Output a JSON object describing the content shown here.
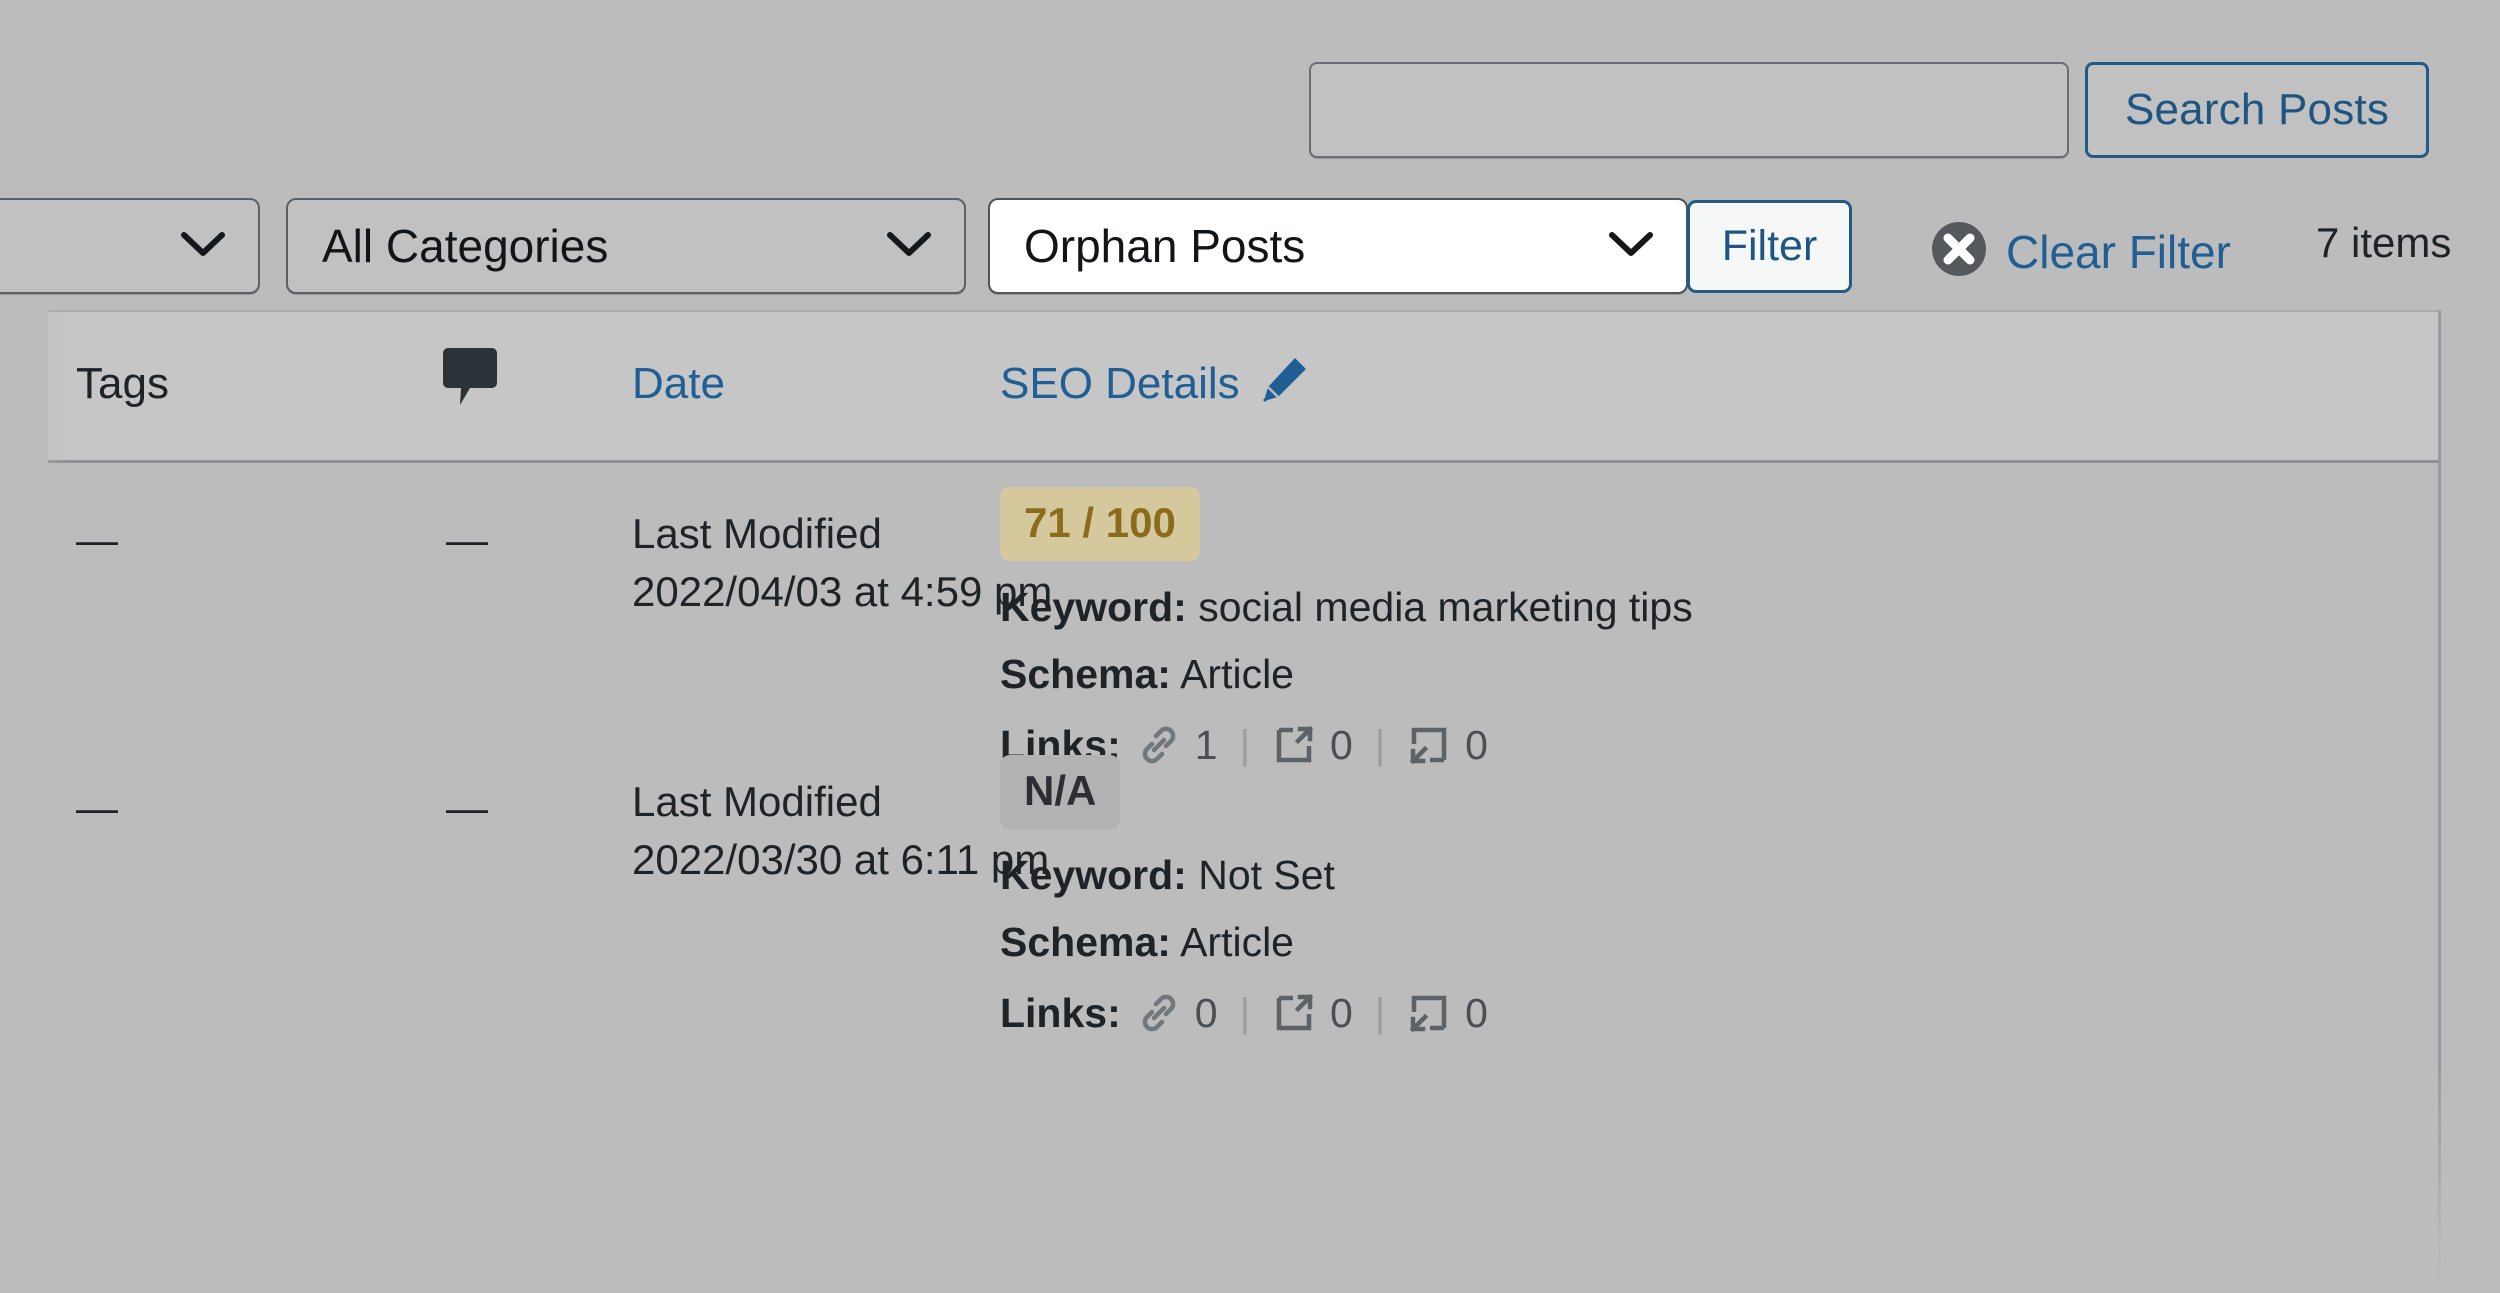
{
  "search": {
    "value": "",
    "placeholder": "",
    "button_label": "Search Posts"
  },
  "filters": {
    "post_type": {
      "label": "",
      "icon": "chevron-down-icon"
    },
    "category": {
      "label": "All Categories",
      "icon": "chevron-down-icon"
    },
    "view": {
      "label": "Orphan Posts",
      "icon": "chevron-down-icon"
    },
    "filter_button_label": "Filter",
    "clear_filter_label": "Clear Filter",
    "clear_filter_icon": "clear-circle-x-icon",
    "items_count": "7 items"
  },
  "table": {
    "headers": {
      "tags": "Tags",
      "comments_icon": "comment-bubble-icon",
      "date": "Date",
      "seo_details": "SEO Details",
      "seo_edit_icon": "pencil-icon"
    },
    "rows": [
      {
        "tags": "—",
        "comments": "—",
        "date_label": "Last Modified",
        "date_value": "2022/04/03 at 4:59 pm",
        "score": "71 / 100",
        "score_state": "ok",
        "keyword_label": "Keyword:",
        "keyword_value": "social media marketing tips",
        "schema_label": "Schema:",
        "schema_value": "Article",
        "links_label": "Links:",
        "links_internal": "1",
        "links_external": "0",
        "links_inbound": "0"
      },
      {
        "tags": "—",
        "comments": "—",
        "date_label": "Last Modified",
        "date_value": "2022/03/30 at 6:11 pm",
        "score": "N/A",
        "score_state": "na",
        "keyword_label": "Keyword:",
        "keyword_value": "Not Set",
        "schema_label": "Schema:",
        "schema_value": "Article",
        "links_label": "Links:",
        "links_internal": "0",
        "links_external": "0",
        "links_inbound": "0"
      }
    ]
  },
  "colors": {
    "page_bg": "#bcbcbc",
    "accent_link": "#1f5f95",
    "button_border": "#225b86",
    "score_ok_bg": "#d5c89c",
    "score_ok_text": "#8a6c1c",
    "score_na_bg": "#b2b2b2",
    "text": "#1d2327"
  }
}
